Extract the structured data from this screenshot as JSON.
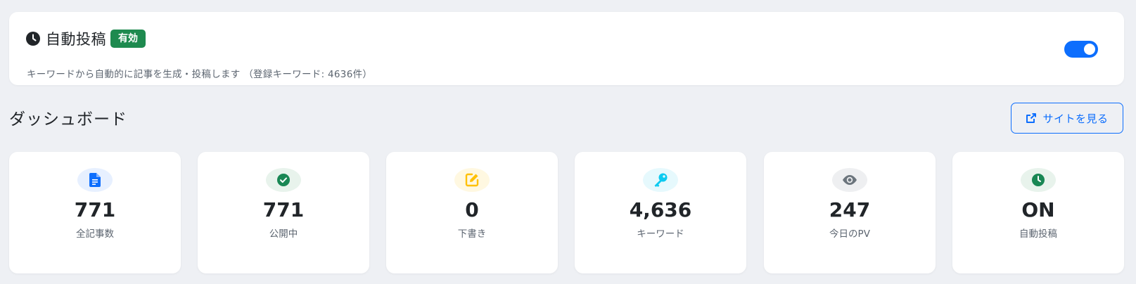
{
  "auto_post": {
    "title": "自動投稿",
    "badge": "有効",
    "description": "キーワードから自動的に記事を生成・投稿します （登録キーワード: 4636件）",
    "enabled": true
  },
  "dashboard": {
    "title": "ダッシュボード",
    "view_site_label": "サイトを見る"
  },
  "stats": [
    {
      "value": "771",
      "label": "全記事数",
      "icon": "document-icon",
      "color": "#0d6efd",
      "bg": "#e7f0ff"
    },
    {
      "value": "771",
      "label": "公開中",
      "icon": "check-circle-icon",
      "color": "#198754",
      "bg": "#e8f3ec"
    },
    {
      "value": "0",
      "label": "下書き",
      "icon": "edit-icon",
      "color": "#ffc107",
      "bg": "#fff8e1"
    },
    {
      "value": "4,636",
      "label": "キーワード",
      "icon": "key-icon",
      "color": "#0dcaf0",
      "bg": "#e6f9fd"
    },
    {
      "value": "247",
      "label": "今日のPV",
      "icon": "eye-icon",
      "color": "#6c757d",
      "bg": "#eeeff1"
    },
    {
      "value": "ON",
      "label": "自動投稿",
      "icon": "clock-icon",
      "color": "#198754",
      "bg": "#e8f3ec"
    }
  ],
  "colors": {
    "primary": "#0d6efd",
    "success": "#1e8a4f",
    "background": "#eef0f4"
  }
}
